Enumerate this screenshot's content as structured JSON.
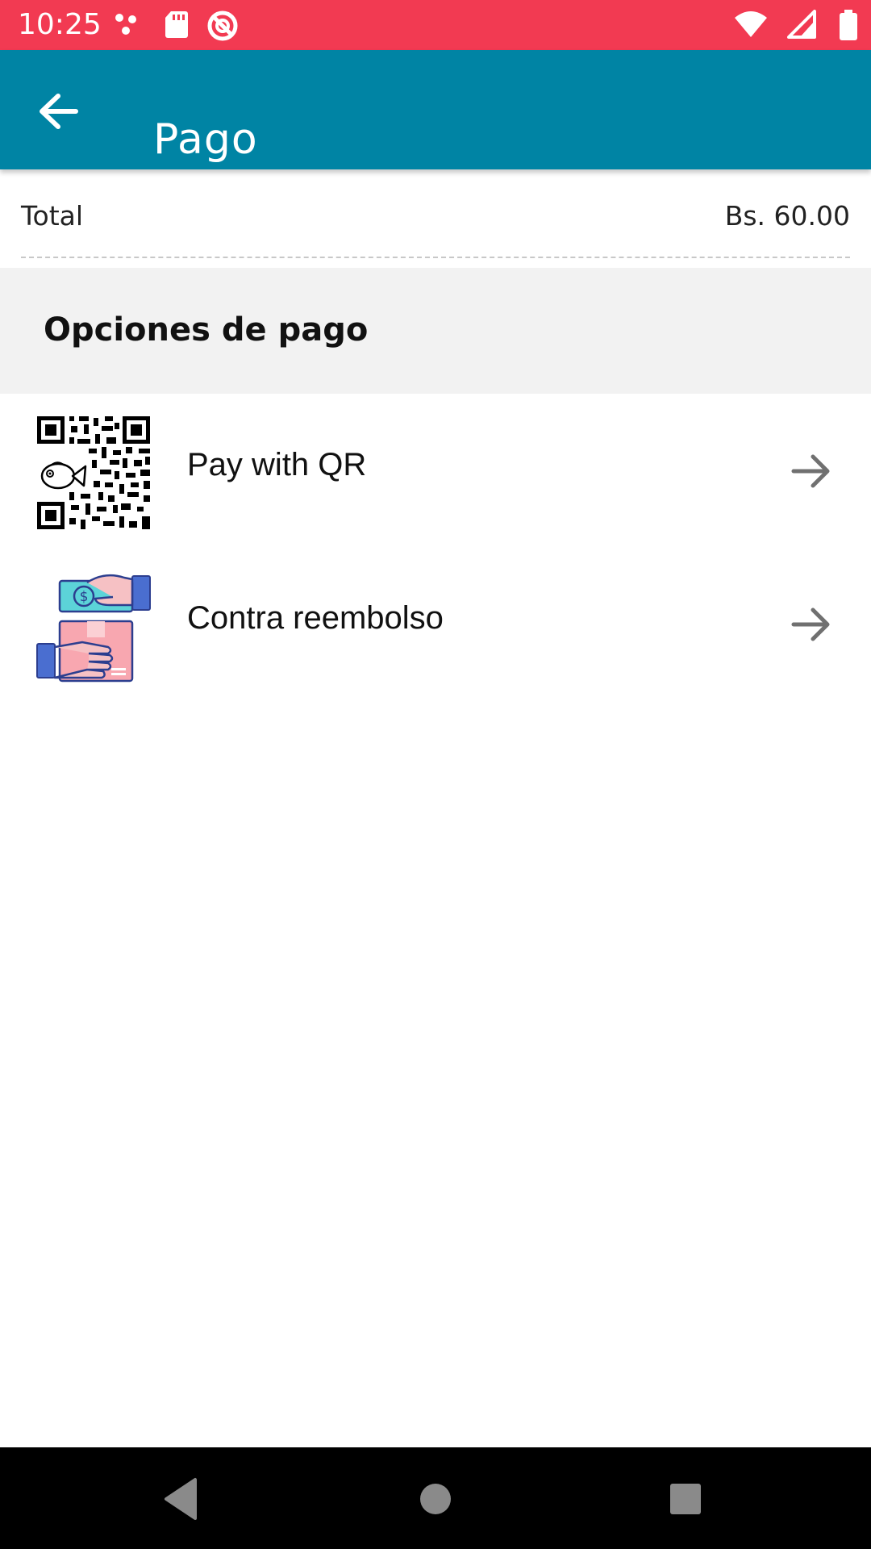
{
  "status_bar": {
    "time": "10:25",
    "icons_left": [
      "dots-icon",
      "sd-card-icon",
      "no-disturb-icon"
    ],
    "icons_right": [
      "wifi-icon",
      "signal-icon",
      "battery-icon"
    ],
    "background": "#f23a52"
  },
  "app_bar": {
    "title": "Pago",
    "background": "#0084a4"
  },
  "summary": {
    "total_label": "Total",
    "total_value": "Bs. 60.00"
  },
  "section": {
    "title": "Opciones de pago"
  },
  "payment_options": [
    {
      "label": "Pay with QR",
      "icon": "qr-code-icon"
    },
    {
      "label": "Contra reembolso",
      "icon": "cash-on-delivery-icon"
    }
  ],
  "nav_bar": {
    "buttons": [
      "back-triangle-icon",
      "home-circle-icon",
      "recents-square-icon"
    ]
  }
}
